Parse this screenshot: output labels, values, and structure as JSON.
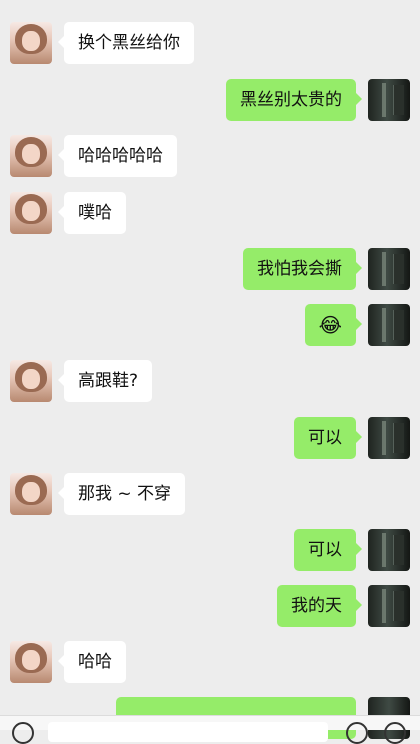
{
  "messages": [
    {
      "side": "left",
      "text": "换个黑丝给你"
    },
    {
      "side": "right",
      "text": "黑丝别太贵的"
    },
    {
      "side": "left",
      "text": "哈哈哈哈哈"
    },
    {
      "side": "left",
      "text": "噗哈"
    },
    {
      "side": "right",
      "text": "我怕我会撕"
    },
    {
      "side": "right",
      "text": "😂"
    },
    {
      "side": "left",
      "text": "高跟鞋?"
    },
    {
      "side": "right",
      "text": "可以"
    },
    {
      "side": "left",
      "text": "那我 ~ 不穿"
    },
    {
      "side": "right",
      "text": "可以"
    },
    {
      "side": "right",
      "text": "我的天"
    },
    {
      "side": "left",
      "text": "哈哈"
    }
  ],
  "icons": {
    "voice": "voice-icon",
    "emoji": "emoji-icon",
    "more": "plus-icon"
  }
}
